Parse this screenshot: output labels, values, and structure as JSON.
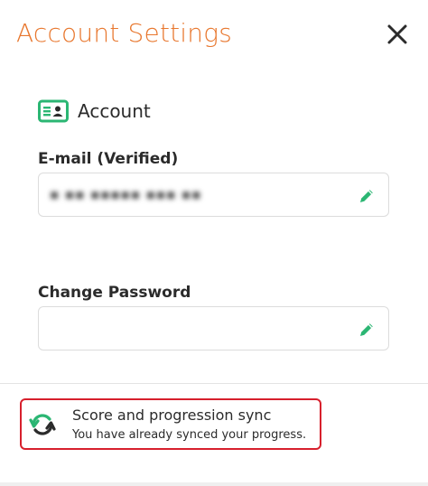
{
  "header": {
    "title": "Account Settings"
  },
  "account": {
    "section_title": "Account",
    "email": {
      "label": "E-mail (Verified)",
      "value": "▪ ▪▪ ▪▪▪▪▪ ▪▪▪ ▪▪"
    },
    "password": {
      "label": "Change Password",
      "value": ""
    }
  },
  "sync": {
    "title": "Score and progression sync",
    "status": "You have already synced your progress."
  },
  "colors": {
    "accent": "#e8772e",
    "edit_icon": "#2bb673",
    "highlight_border": "#d7202d"
  },
  "icons": {
    "close": "close-icon",
    "account": "id-card-icon",
    "edit": "pencil-icon",
    "sync": "sync-icon"
  }
}
